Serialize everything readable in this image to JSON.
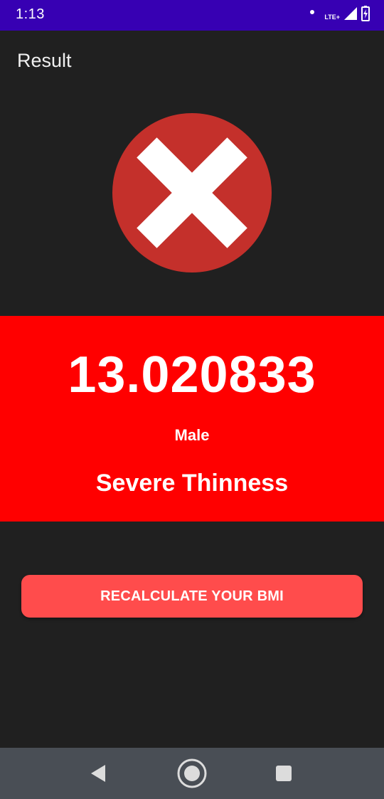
{
  "status_bar": {
    "time": "1:13",
    "network_label": "LTE+",
    "icons": [
      "notification-dot-icon",
      "lte-icon",
      "signal-icon",
      "battery-charging-icon"
    ],
    "background_color": "#3700b3"
  },
  "app_bar": {
    "title": "Result"
  },
  "result": {
    "icon": "cross-icon",
    "icon_color": "#c4302b",
    "bmi_value": "13.020833",
    "gender": "Male",
    "category": "Severe Thinness",
    "band_color": "#ff0000"
  },
  "actions": {
    "recalculate_label": "RECALCULATE YOUR BMI",
    "button_color": "#ff4c4c"
  },
  "nav_bar": {
    "buttons": [
      "back-icon",
      "home-icon",
      "recents-icon"
    ]
  }
}
